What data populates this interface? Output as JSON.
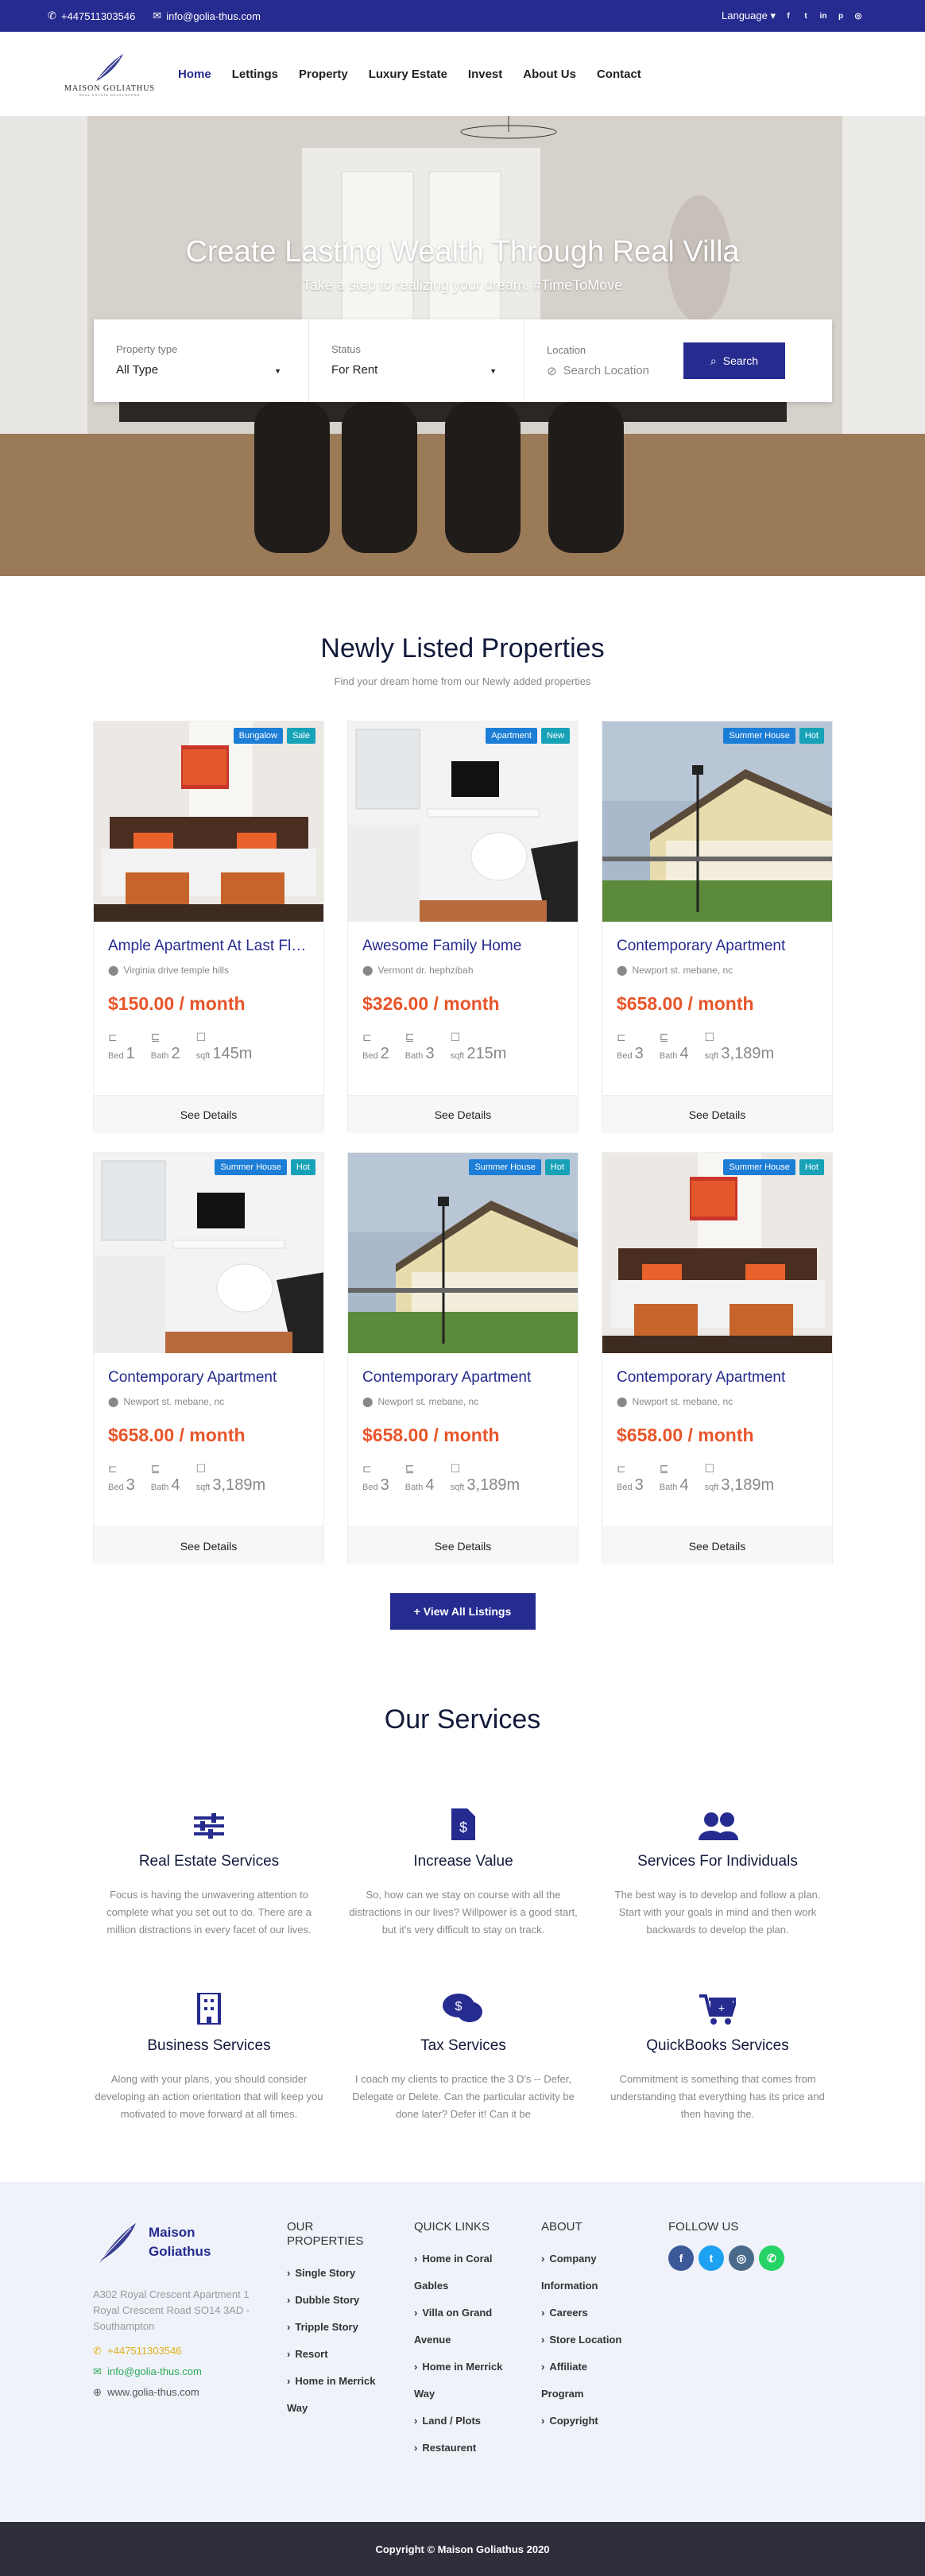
{
  "topbar": {
    "phone": "+447511303546",
    "email": "info@golia-thus.com",
    "language": "Language"
  },
  "brand": {
    "name": "MAISON GOLIATHUS",
    "tagline": "REAL ESTATE DEVELOPERS"
  },
  "nav": [
    "Home",
    "Lettings",
    "Property",
    "Luxury Estate",
    "Invest",
    "About Us",
    "Contact"
  ],
  "hero": {
    "title": "Create Lasting Wealth Through Real Villa",
    "subtitle": "Take a step to realizing your dream. #TimeToMove"
  },
  "search": {
    "type_label": "Property type",
    "type_value": "All Type",
    "status_label": "Status",
    "status_value": "For Rent",
    "location_label": "Location",
    "location_placeholder": "Search Location",
    "button": "Search"
  },
  "listings": {
    "title": "Newly Listed Properties",
    "subtitle": "Find your dream home from our Newly added properties",
    "see_details": "See Details",
    "view_all": "View All Listings",
    "items": [
      {
        "badge1": "Bungalow",
        "badge2": "Sale",
        "title": "Ample Apartment At Last Floor",
        "address": "Virginia drive temple hills",
        "price": "$150.00 / month",
        "bed": "1",
        "bath": "2",
        "sqft": "145m",
        "img": "bedroom"
      },
      {
        "badge1": "Apartment",
        "badge2": "New",
        "title": "Awesome Family Home",
        "address": "Vermont dr. hephzibah",
        "price": "$326.00 / month",
        "bed": "2",
        "bath": "3",
        "sqft": "215m",
        "img": "office"
      },
      {
        "badge1": "Summer House",
        "badge2": "Hot",
        "title": "Contemporary Apartment",
        "address": "Newport st. mebane, nc",
        "price": "$658.00 / month",
        "bed": "3",
        "bath": "4",
        "sqft": "3,189m",
        "img": "houses"
      },
      {
        "badge1": "Summer House",
        "badge2": "Hot",
        "title": "Contemporary Apartment",
        "address": "Newport st. mebane, nc",
        "price": "$658.00 / month",
        "bed": "3",
        "bath": "4",
        "sqft": "3,189m",
        "img": "office"
      },
      {
        "badge1": "Summer House",
        "badge2": "Hot",
        "title": "Contemporary Apartment",
        "address": "Newport st. mebane, nc",
        "price": "$658.00 / month",
        "bed": "3",
        "bath": "4",
        "sqft": "3,189m",
        "img": "houses"
      },
      {
        "badge1": "Summer House",
        "badge2": "Hot",
        "title": "Contemporary Apartment",
        "address": "Newport st. mebane, nc",
        "price": "$658.00 / month",
        "bed": "3",
        "bath": "4",
        "sqft": "3,189m",
        "img": "bedroom"
      }
    ],
    "labels": {
      "bed": "Bed",
      "bath": "Bath",
      "sqft": "sqft"
    }
  },
  "services": {
    "title": "Our Services",
    "items": [
      {
        "title": "Real Estate Services",
        "text": "Focus is having the unwavering attention to complete what you set out to do. There are a million distractions in every facet of our lives.",
        "icon": "sliders-icon"
      },
      {
        "title": "Increase Value",
        "text": "So, how can we stay on course with all the distractions in our lives? Willpower is a good start, but it's very difficult to stay on track.",
        "icon": "dollar-file-icon"
      },
      {
        "title": "Services For Individuals",
        "text": "The best way is to develop and follow a plan. Start with your goals in mind and then work backwards to develop the plan.",
        "icon": "users-icon"
      },
      {
        "title": "Business Services",
        "text": "Along with your plans, you should consider developing an action orientation that will keep you motivated to move forward at all times.",
        "icon": "building-icon"
      },
      {
        "title": "Tax Services",
        "text": "I coach my clients to practice the 3 D's -- Defer, Delegate or Delete. Can the particular activity be done later? Defer it! Can it be",
        "icon": "chat-dollar-icon"
      },
      {
        "title": "QuickBooks Services",
        "text": "Commitment is something that comes from understanding that everything has its price and then having the.",
        "icon": "cart-icon"
      }
    ]
  },
  "footer": {
    "brand": "Maison Goliathus",
    "address": "A302 Royal Crescent Apartment 1 Royal Crescent Road SO14 3AD - Southampton",
    "phone": "+447511303546",
    "email": "info@golia-thus.com",
    "web": "www.golia-thus.com",
    "col1_title": "OUR PROPERTIES",
    "col1": [
      "Single Story",
      "Dubble Story",
      "Tripple Story",
      "Resort",
      "Home in Merrick Way"
    ],
    "col2_title": "QUICK LINKS",
    "col2": [
      "Home in Coral Gables",
      "Villa on Grand Avenue",
      "Home in Merrick Way",
      "Land / Plots",
      "Restaurent"
    ],
    "col3_title": "ABOUT",
    "col3": [
      "Company Information",
      "Careers",
      "Store Location",
      "Affiliate Program",
      "Copyright"
    ],
    "col4_title": "FOLLOW US",
    "social": [
      {
        "name": "facebook-icon",
        "glyph": "f",
        "color": "#3b5998"
      },
      {
        "name": "twitter-icon",
        "glyph": "t",
        "color": "#1da1f2"
      },
      {
        "name": "instagram-icon",
        "glyph": "◎",
        "color": "#4a6a8c"
      },
      {
        "name": "whatsapp-icon",
        "glyph": "✆",
        "color": "#25d366"
      }
    ]
  },
  "copyright": "Copyright © Maison Goliathus 2020",
  "colors": {
    "primary": "#262b8f",
    "price": "#e8552a",
    "badge_blue": "#1c7ed6",
    "badge_teal": "#17a2b8"
  }
}
